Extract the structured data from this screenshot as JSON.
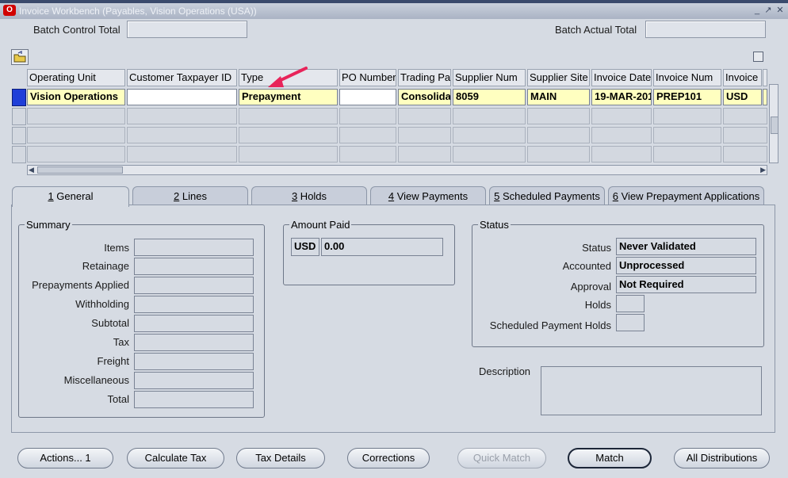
{
  "window": {
    "title": "Invoice Workbench (Payables, Vision Operations (USA))",
    "logo_text": "O"
  },
  "batch": {
    "control_total_label": "Batch Control Total",
    "actual_total_label": "Batch Actual Total"
  },
  "grid": {
    "columns": [
      "Operating Unit",
      "Customer Taxpayer ID",
      "Type",
      "PO Number",
      "Trading Pa",
      "Supplier Num",
      "Supplier Site",
      "Invoice Date",
      "Invoice Num",
      "Invoice"
    ],
    "row1": {
      "operating_unit": "Vision Operations",
      "customer_taxpayer_id": "",
      "type": "Prepayment",
      "po_number": "",
      "trading_partner": "Consolida",
      "supplier_num": "8059",
      "supplier_site": "MAIN",
      "invoice_date": "19-MAR-201",
      "invoice_num": "PREP101",
      "invoice_currency": "USD"
    }
  },
  "tabs": [
    {
      "num": "1",
      "label": " General"
    },
    {
      "num": "2",
      "label": " Lines"
    },
    {
      "num": "3",
      "label": " Holds"
    },
    {
      "num": "4",
      "label": " View Payments"
    },
    {
      "num": "5",
      "label": " Scheduled Payments"
    },
    {
      "num": "6",
      "label": " View Prepayment Applications"
    }
  ],
  "summary": {
    "title": "Summary",
    "labels": [
      "Items",
      "Retainage",
      "Prepayments Applied",
      "Withholding",
      "Subtotal",
      "Tax",
      "Freight",
      "Miscellaneous",
      "Total"
    ]
  },
  "amount_paid": {
    "title": "Amount Paid",
    "currency": "USD",
    "value": "0.00"
  },
  "status": {
    "title": "Status",
    "status_label": "Status",
    "status_value": "Never Validated",
    "accounted_label": "Accounted",
    "accounted_value": "Unprocessed",
    "approval_label": "Approval",
    "approval_value": "Not Required",
    "holds_label": "Holds",
    "sched_holds_label": "Scheduled Payment Holds"
  },
  "description_label": "Description",
  "buttons": {
    "actions": "Actions... 1",
    "calculate_tax": "Calculate Tax",
    "tax_details": "Tax Details",
    "corrections": "Corrections",
    "quick_match": "Quick Match",
    "match": "Match",
    "all_distributions": "All Distributions"
  },
  "colors": {
    "required_field": "#ffffc0",
    "annotation_arrow": "#e8245a",
    "row_indicator": "#1f3fd8"
  }
}
